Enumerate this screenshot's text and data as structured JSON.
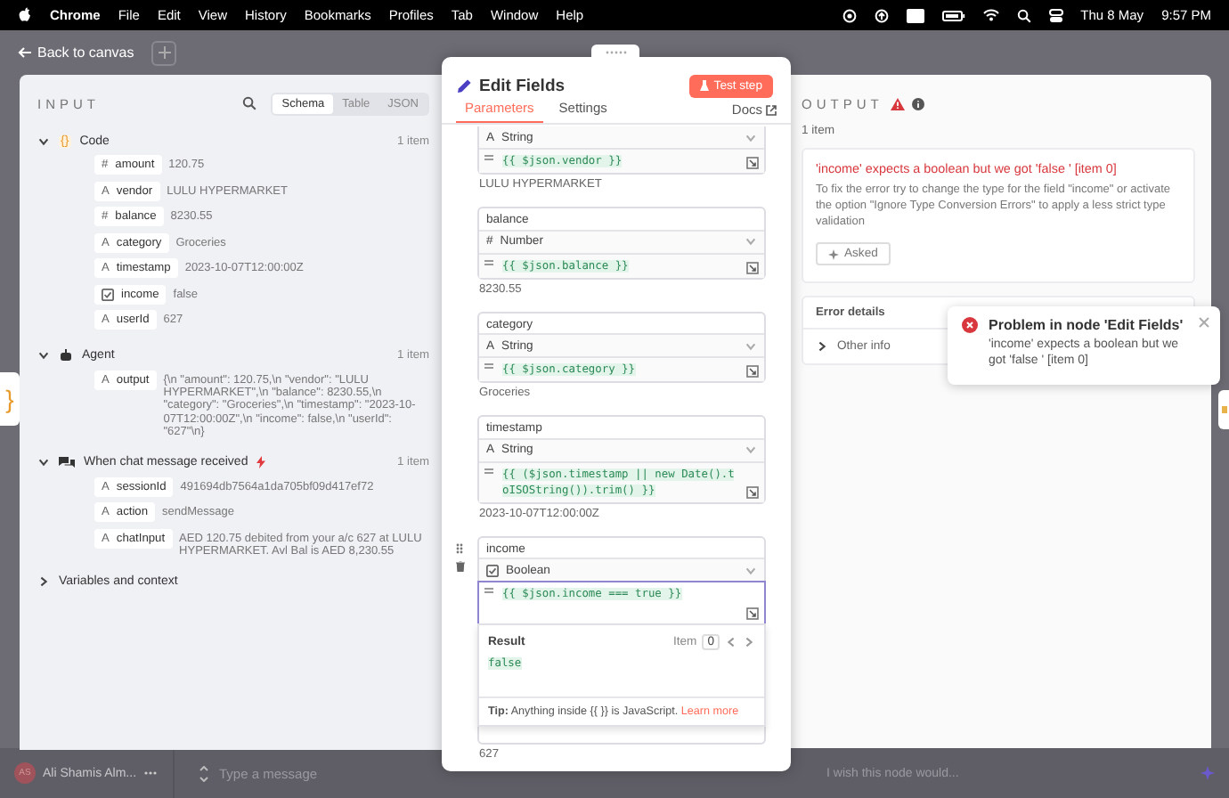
{
  "menu_bar": {
    "app": "Chrome",
    "items": [
      "File",
      "Edit",
      "View",
      "History",
      "Bookmarks",
      "Profiles",
      "Tab",
      "Window",
      "Help"
    ],
    "date": "Thu 8 May",
    "time": "9:57 PM"
  },
  "canvas": {
    "back_link": "Back to canvas",
    "node_edge_left": "}"
  },
  "input_panel": {
    "title": "INPUT",
    "view_tabs": [
      {
        "label": "Schema",
        "selected": true
      },
      {
        "label": "Table",
        "selected": false
      },
      {
        "label": "JSON",
        "selected": false
      }
    ],
    "nodes": [
      {
        "kind": "code",
        "badge": "{}",
        "name": "Code",
        "count": "1 item",
        "expanded": true,
        "fields": [
          {
            "kind": "number",
            "type_mark": "#",
            "key": "amount",
            "value": "120.75"
          },
          {
            "kind": "string",
            "type_mark": "A",
            "key": "vendor",
            "value": "LULU HYPERMARKET"
          },
          {
            "kind": "number",
            "type_mark": "#",
            "key": "balance",
            "value": "8230.55"
          },
          {
            "kind": "string",
            "type_mark": "A",
            "key": "category",
            "value": "Groceries"
          },
          {
            "kind": "string",
            "type_mark": "A",
            "key": "timestamp",
            "value": "2023-10-07T12:00:00Z"
          },
          {
            "kind": "boolean",
            "key": "income",
            "value": "false"
          },
          {
            "kind": "string",
            "type_mark": "A",
            "key": "userId",
            "value": "627"
          }
        ]
      },
      {
        "kind": "agent",
        "name": "Agent",
        "count": "1 item",
        "expanded": true,
        "fields": [
          {
            "kind": "string",
            "type_mark": "A",
            "key": "output",
            "value": "{\\n \"amount\": 120.75,\\n \"vendor\": \"LULU HYPERMARKET\",\\n \"balance\": 8230.55,\\n \"category\": \"Groceries\",\\n \"timestamp\": \"2023-10-07T12:00:00Z\",\\n \"income\": false,\\n \"userId\": \"627\"\\n}"
          }
        ]
      },
      {
        "kind": "chat",
        "name": "When chat message received",
        "count": "1 item",
        "expanded": true,
        "fields": [
          {
            "kind": "string",
            "type_mark": "A",
            "key": "sessionId",
            "value": "491694db7564a1da705bf09d417ef72"
          },
          {
            "kind": "string",
            "type_mark": "A",
            "key": "action",
            "value": "sendMessage"
          },
          {
            "kind": "string",
            "type_mark": "A",
            "key": "chatInput",
            "value": "AED 120.75 debited from your a/c 627 at LULU HYPERMARKET. Avl Bal is AED 8,230.55"
          }
        ]
      },
      {
        "kind": "group",
        "name": "Variables and context",
        "expanded": false
      }
    ]
  },
  "edit_panel": {
    "title": "Edit Fields",
    "test_button": "Test step",
    "tabs": [
      {
        "label": "Parameters",
        "selected": true
      },
      {
        "label": "Settings",
        "selected": false
      }
    ],
    "docs_link": "Docs",
    "fields": [
      {
        "kind": "string",
        "type_mark": "A",
        "type_label": "String",
        "expression": "{{ $json.vendor }}",
        "preview": "LULU HYPERMARKET",
        "focused": false
      },
      {
        "name": "balance",
        "kind": "number",
        "type_mark": "#",
        "type_label": "Number",
        "expression": "{{ $json.balance }}",
        "preview": "8230.55",
        "focused": false
      },
      {
        "name": "category",
        "kind": "string",
        "type_mark": "A",
        "type_label": "String",
        "expression": "{{ $json.category }}",
        "preview": "Groceries",
        "focused": false
      },
      {
        "name": "timestamp",
        "kind": "string",
        "type_mark": "A",
        "type_label": "String",
        "expression": "{{ ($json.timestamp || new Date().toISOString()).trim() }}",
        "preview": "2023-10-07T12:00:00Z",
        "focused": false
      },
      {
        "name": "income",
        "kind": "boolean",
        "type_label": "Boolean",
        "expression": "{{ $json.income === true }}",
        "focused": true,
        "result": {
          "label": "Result",
          "item_label": "Item",
          "item_index": "0",
          "value": "false",
          "tip": "**Tip:** Anything inside {{ }} is JavaScript.",
          "tip_link": "Learn more"
        }
      },
      {
        "preview": "627",
        "focused": false
      }
    ]
  },
  "output_panel": {
    "title": "OUTPUT",
    "item_count": "1 item",
    "error": {
      "title": "'income' expects a boolean but we got 'false ' [item 0]",
      "description": "To fix the error try to change the type for the field \"income\" or activate the option \"Ignore Type Conversion Errors\" to apply a less strict type validation",
      "ask_button": "Asked"
    },
    "details": {
      "title": "Error details",
      "sections": [
        {
          "label": "Other info",
          "expanded": false
        }
      ]
    }
  },
  "toast": {
    "title": "Problem in node 'Edit Fields'",
    "message": "'income' expects a boolean but we got 'false ' [item 0]"
  },
  "bottom_bar": {
    "avatar_initials": "AS",
    "user_name": "Ali Shamis Alm...",
    "message_placeholder": "Type a message",
    "feedback_placeholder": "I wish this node would..."
  }
}
